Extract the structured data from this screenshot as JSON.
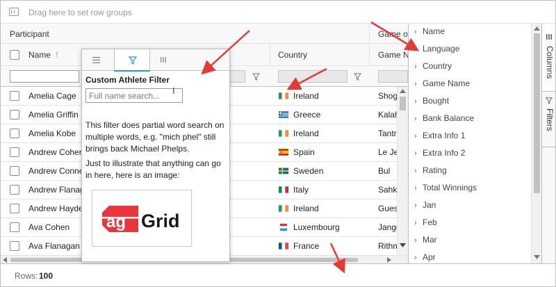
{
  "row_group_bar": {
    "placeholder": "Drag here to set row groups"
  },
  "header_groups": {
    "participant": "Participant",
    "game_of": "Game of"
  },
  "columns": {
    "name": "Name",
    "sort_indicator": "↑",
    "country": "Country",
    "game_name": "Game N"
  },
  "rows": [
    {
      "name": "Amelia Cage",
      "country": "Ireland",
      "flag": "ireland",
      "game": "Shog"
    },
    {
      "name": "Amelia Griffin",
      "country": "Greece",
      "flag": "greece",
      "game": "Kalah"
    },
    {
      "name": "Amelia Kobe",
      "country": "Ireland",
      "flag": "ireland",
      "game": "Tantr"
    },
    {
      "name": "Andrew Cohen",
      "country": "Spain",
      "flag": "spain",
      "game": "Le Je"
    },
    {
      "name": "Andrew Conne",
      "country": "Sweden",
      "flag": "sweden",
      "game": "Bul"
    },
    {
      "name": "Andrew Flanag",
      "country": "Italy",
      "flag": "italy",
      "game": "Sahkl"
    },
    {
      "name": "Andrew Hayde",
      "country": "Ireland",
      "flag": "ireland",
      "game": "Gues"
    },
    {
      "name": "Ava Cohen",
      "country": "Luxembourg",
      "flag": "luxembourg",
      "game": "Jangg"
    },
    {
      "name": "Ava Flanagan",
      "country": "France",
      "flag": "france",
      "game": "Rithm"
    }
  ],
  "filter_popup": {
    "title": "Custom Athlete Filter",
    "search_placeholder": "Full name search...",
    "description": "This filter does partial word search on multiple words, e.g. \"mich phel\" still brings back Michael Phelps.",
    "description2": "Just to illustrate that anything can go in here, here is an image:",
    "logo_ag": "ag",
    "logo_grid": "Grid"
  },
  "columns_panel": {
    "items": [
      "Name",
      "Language",
      "Country",
      "Game Name",
      "Bought",
      "Bank Balance",
      "Extra Info 1",
      "Extra Info 2",
      "Rating",
      "Total Winnings",
      "Jan",
      "Feb",
      "Mar",
      "Apr"
    ]
  },
  "side_tabs": {
    "columns": "Columns",
    "filters": "Filters"
  },
  "status": {
    "rows_label": "Rows:",
    "rows_value": "100"
  },
  "colors": {
    "accent": "#2196f3",
    "annotation_arrow": "#e53935"
  }
}
